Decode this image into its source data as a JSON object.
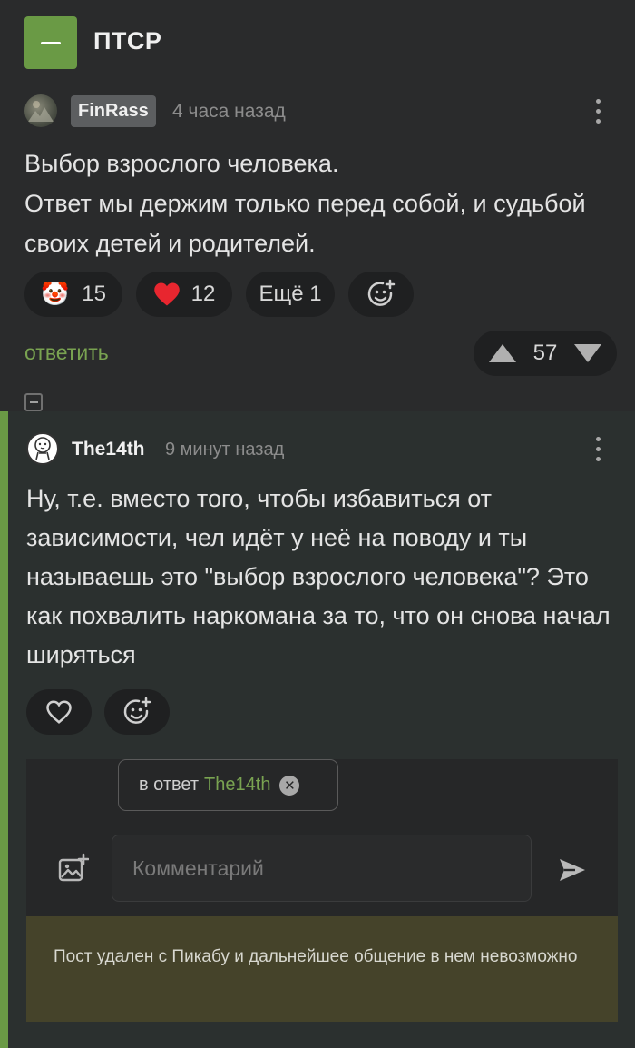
{
  "header": {
    "title": "ПТСР"
  },
  "comment1": {
    "author": "FinRass",
    "time": "4 часа назад",
    "text": "Выбор взрослого человека.\nОтвет мы держим только перед собой, и судьбой своих детей и родителей.",
    "reactions": [
      {
        "icon": "clown-emoji",
        "emoji": "🤡",
        "count": "15"
      },
      {
        "icon": "heart-icon",
        "count": "12"
      }
    ],
    "more_reactions": "Ещё 1",
    "reply_label": "ответить",
    "rating": "57"
  },
  "comment2": {
    "author": "The14th",
    "time": "9 минут назад",
    "text": "Ну, т.е. вместо того, чтобы избавиться от зависимости, чел идёт у неё на поводу и ты называешь это \"выбор взрослого человека\"? Это как похвалить наркомана за то, что он снова начал ширяться"
  },
  "composer": {
    "reply_prefix": "в ответ",
    "reply_user": "The14th",
    "placeholder": "Комментарий",
    "deleted_notice": "Пост удален с Пикабу и дальнейшее общение в нем невозможно"
  },
  "colors": {
    "accent": "#6a9a45",
    "link": "#79a351",
    "background": "#2a2b2c",
    "notice": "#45432a",
    "heart": "#e8262f"
  }
}
